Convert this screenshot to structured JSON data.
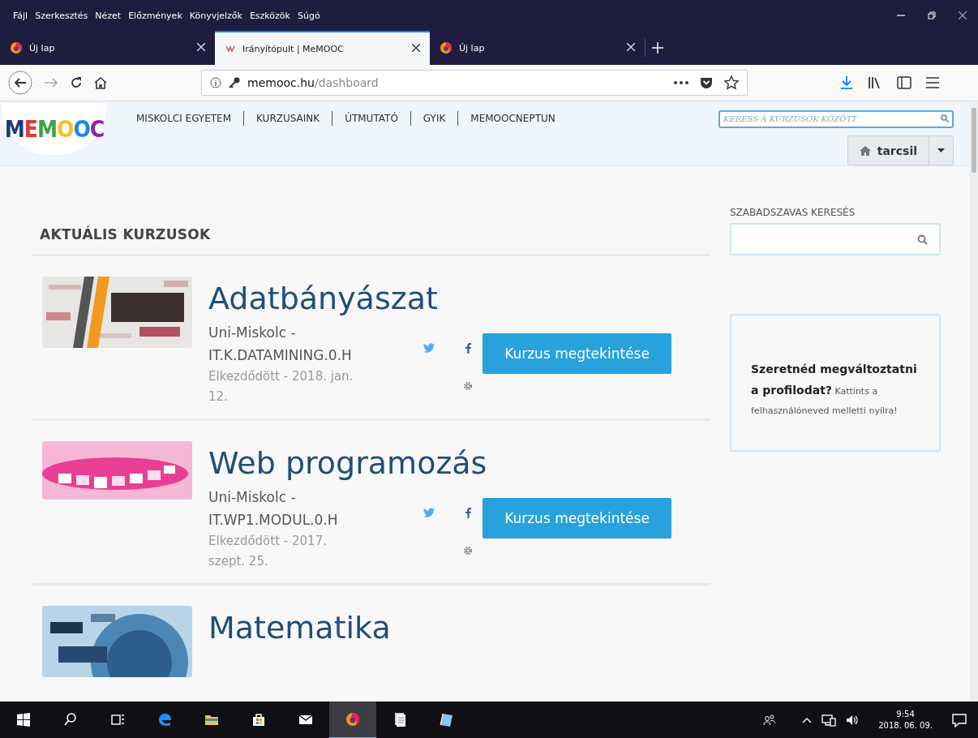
{
  "menubar": [
    "Fájl",
    "Szerkesztés",
    "Nézet",
    "Előzmények",
    "Könyvjelzők",
    "Eszközök",
    "Súgó"
  ],
  "tabs": [
    {
      "label": "Új lap",
      "selected": false,
      "kind": "firefox"
    },
    {
      "label": "Irányítópult | MeMOOC",
      "selected": true,
      "kind": "site"
    },
    {
      "label": "Új lap",
      "selected": false,
      "kind": "firefox"
    }
  ],
  "address": {
    "host": "memooc.hu",
    "path": "/dashboard"
  },
  "site": {
    "logo": "MEMOOC",
    "nav": [
      "MISKOLCI EGYETEM",
      "KURZUSAINK",
      "ÚTMUTATÓ",
      "GYIK",
      "MEMOOCNEPTUN"
    ],
    "search_placeholder": "KERESS A KURZUSOK KÖZÖTT",
    "user": "tarcsil"
  },
  "section_title": "AKTUÁLIS KURZUSOK",
  "courses": [
    {
      "title": "Adatbányászat",
      "code": "Uni-Miskolc - IT.K.DATAMINING.0.H",
      "started": "Elkezdődött - 2018. jan. 12.",
      "button": "Kurzus megtekintése"
    },
    {
      "title": "Web programozás",
      "code": "Uni-Miskolc - IT.WP1.MODUL.0.H",
      "started": "Elkezdődött - 2017. szept. 25.",
      "button": "Kurzus megtekintése"
    },
    {
      "title": "Matematika"
    }
  ],
  "sidebar": {
    "search_label": "SZABADSZAVAS KERESÉS",
    "promo": "**Szeretnéd megváltoztatni a profilodat?** Kattints a felhasználóneved melletti nyílra!"
  },
  "taskbar": {
    "time": "9:54",
    "date": "2018. 06. 09."
  }
}
